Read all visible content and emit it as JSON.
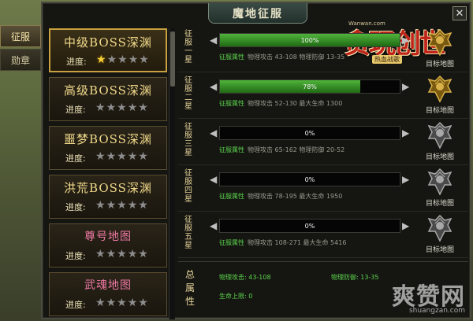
{
  "window": {
    "title": "魔地征服"
  },
  "side_tabs": [
    {
      "label": "征服",
      "active": true
    },
    {
      "label": "勋章",
      "active": false
    }
  ],
  "logo": {
    "site": "Wanwan.com",
    "main": "贪玩创世",
    "sub": "热血战歌"
  },
  "maps": [
    {
      "name": "中级BOSS深渊",
      "progress_label": "进度:",
      "stars_filled": 1,
      "stars_total": 5,
      "selected": true
    },
    {
      "name": "高级BOSS深渊",
      "progress_label": "进度:",
      "stars_filled": 0,
      "stars_total": 5
    },
    {
      "name": "噩梦BOSS深渊",
      "progress_label": "进度:",
      "stars_filled": 0,
      "stars_total": 5
    },
    {
      "name": "洪荒BOSS深渊",
      "progress_label": "进度:",
      "stars_filled": 0,
      "stars_total": 5
    },
    {
      "name": "尊号地图",
      "progress_label": "进度:",
      "stars_filled": 0,
      "stars_total": 5,
      "pink": true
    },
    {
      "name": "武魂地图",
      "progress_label": "进度:",
      "stars_filled": 0,
      "stars_total": 5,
      "pink": true
    }
  ],
  "conquests": [
    {
      "label": "征服一星",
      "progress": 1.0,
      "progress_text": "100%",
      "attr_title": "征服属性",
      "attrs": "物理攻击 43-108 物理防御 13-35",
      "target_label": "目标地图",
      "target_gold": true
    },
    {
      "label": "征服二星",
      "progress": 0.78,
      "progress_text": "78%",
      "attr_title": "征服属性",
      "attrs": "物理攻击 52-130 最大生命 1300",
      "target_label": "目标地图",
      "target_gold": true
    },
    {
      "label": "征服三星",
      "progress": 0,
      "progress_text": "0%",
      "attr_title": "征服属性",
      "attrs": "物理攻击 65-162 物理防御 20-52",
      "target_label": "目标地图",
      "target_gold": false
    },
    {
      "label": "征服四星",
      "progress": 0,
      "progress_text": "0%",
      "attr_title": "征服属性",
      "attrs": "物理攻击 78-195 最大生命 1950",
      "target_label": "目标地图",
      "target_gold": false
    },
    {
      "label": "征服五星",
      "progress": 0,
      "progress_text": "0%",
      "attr_title": "征服属性",
      "attrs": "物理攻击 108-271 最大生命 5416",
      "target_label": "目标地图",
      "target_gold": false
    }
  ],
  "total": {
    "label": "总属性",
    "phys_attack": "物理攻击: 43-108",
    "phys_defense": "物理防御: 13-35",
    "max_hp": "生命上限: 0"
  },
  "watermark": {
    "big": "爽赞网",
    "small": "shuangzan.com"
  },
  "colors": {
    "accent_gold": "#c9a040",
    "progress_green": "#4fb43a",
    "attr_green": "#5bd34e"
  }
}
